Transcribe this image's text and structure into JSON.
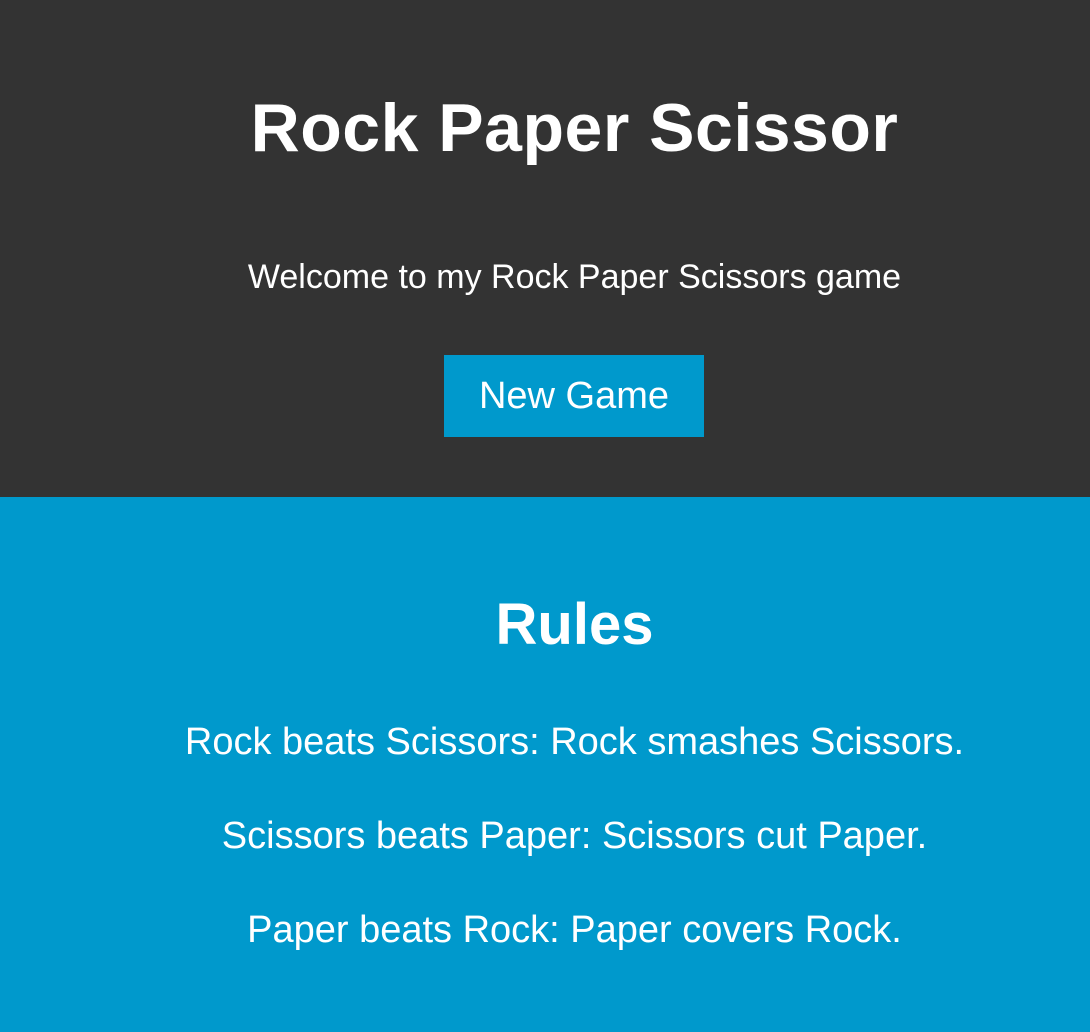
{
  "hero": {
    "title": "Rock Paper Scissor",
    "welcome": "Welcome to my Rock Paper Scissors game",
    "new_game_label": "New Game"
  },
  "rules": {
    "title": "Rules",
    "items": [
      "Rock beats Scissors: Rock smashes Scissors.",
      "Scissors beats Paper: Scissors cut Paper.",
      "Paper beats Rock: Paper covers Rock."
    ]
  },
  "colors": {
    "hero_bg": "#333333",
    "accent": "#0099cc",
    "text": "#ffffff"
  }
}
